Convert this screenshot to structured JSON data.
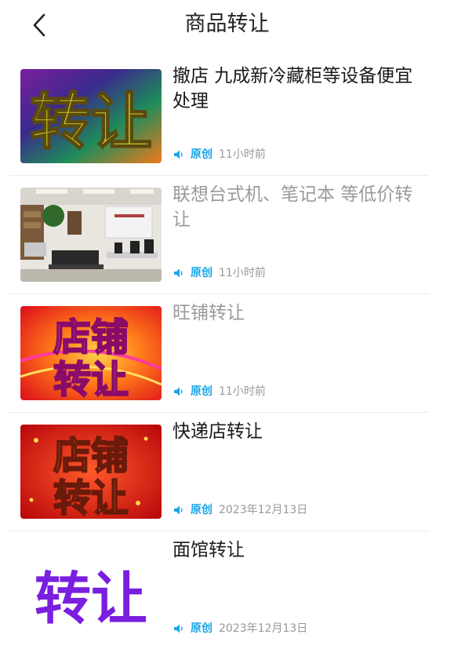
{
  "header": {
    "title": "商品转让",
    "back_icon": "chevron-left-icon"
  },
  "colors": {
    "accent": "#1aa6e8",
    "text": "#1a1a1a",
    "read_text": "#9a9a9a",
    "meta_text": "#999999"
  },
  "items": [
    {
      "title": "撤店 九成新冷藏柜等设备便宜处理",
      "tag": "原创",
      "time": "11小时前",
      "read": false,
      "thumb_text": "转让"
    },
    {
      "title": "联想台式机、笔记本 等低价转让",
      "tag": "原创",
      "time": "11小时前",
      "read": true
    },
    {
      "title": "旺铺转让",
      "tag": "原创",
      "time": "11小时前",
      "read": true,
      "thumb_text_1": "店铺",
      "thumb_text_2": "转让"
    },
    {
      "title": "快递店转让",
      "tag": "原创",
      "time": "2023年12月13日",
      "read": false,
      "thumb_text_1": "店铺",
      "thumb_text_2": "转让"
    },
    {
      "title": "面馆转让",
      "tag": "原创",
      "time": "2023年12月13日",
      "read": false,
      "thumb_text": "转让"
    }
  ]
}
